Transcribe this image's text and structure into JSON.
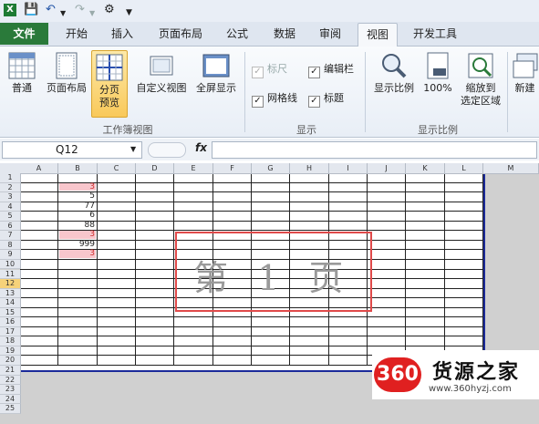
{
  "tabs": {
    "file": "文件",
    "home": "开始",
    "insert": "插入",
    "page_layout": "页面布局",
    "formulas": "公式",
    "data": "数据",
    "review": "审阅",
    "view": "视图",
    "developer": "开发工具"
  },
  "ribbon": {
    "normal": "普通",
    "page_layout": "页面布局",
    "page_break_1": "分页",
    "page_break_2": "预览",
    "custom_views": "自定义视图",
    "full_screen": "全屏显示",
    "group_workbook_views": "工作簿视图",
    "ruler": "标尺",
    "gridlines": "网格线",
    "formula_bar": "编辑栏",
    "headings": "标题",
    "group_show": "显示",
    "zoom": "显示比例",
    "zoom_100": "100%",
    "zoom_selection_1": "缩放到",
    "zoom_selection_2": "选定区域",
    "group_zoom": "显示比例",
    "new_window": "新建"
  },
  "formula_bar": {
    "name_box": "Q12",
    "fx": "fx",
    "content": ""
  },
  "columns": [
    "A",
    "B",
    "C",
    "D",
    "E",
    "F",
    "G",
    "H",
    "I",
    "J",
    "K",
    "L",
    "M"
  ],
  "rows": [
    "1",
    "2",
    "3",
    "4",
    "5",
    "6",
    "7",
    "8",
    "9",
    "10",
    "11",
    "12",
    "13",
    "14",
    "15",
    "16",
    "17",
    "18",
    "19",
    "20",
    "21",
    "22",
    "23",
    "24",
    "25"
  ],
  "cells": [
    {
      "row": "2",
      "col": "B",
      "value": "3",
      "highlight": true
    },
    {
      "row": "3",
      "col": "B",
      "value": "5",
      "highlight": false
    },
    {
      "row": "4",
      "col": "B",
      "value": "77",
      "highlight": false
    },
    {
      "row": "5",
      "col": "B",
      "value": "6",
      "highlight": false
    },
    {
      "row": "6",
      "col": "B",
      "value": "88",
      "highlight": false
    },
    {
      "row": "7",
      "col": "B",
      "value": "3",
      "highlight": true
    },
    {
      "row": "8",
      "col": "B",
      "value": "999",
      "highlight": false
    },
    {
      "row": "9",
      "col": "B",
      "value": "3",
      "highlight": true
    }
  ],
  "page_watermark": "第 1 页",
  "watermark_logo": {
    "badge": "360",
    "name": "货源之家",
    "url": "www.360hyzj.com"
  },
  "colors": {
    "file_tab": "#2a7a3a",
    "page_border": "#1b2a9a",
    "watermark_box": "#e04a4a",
    "highlight_cell": "#f8c6cc"
  }
}
